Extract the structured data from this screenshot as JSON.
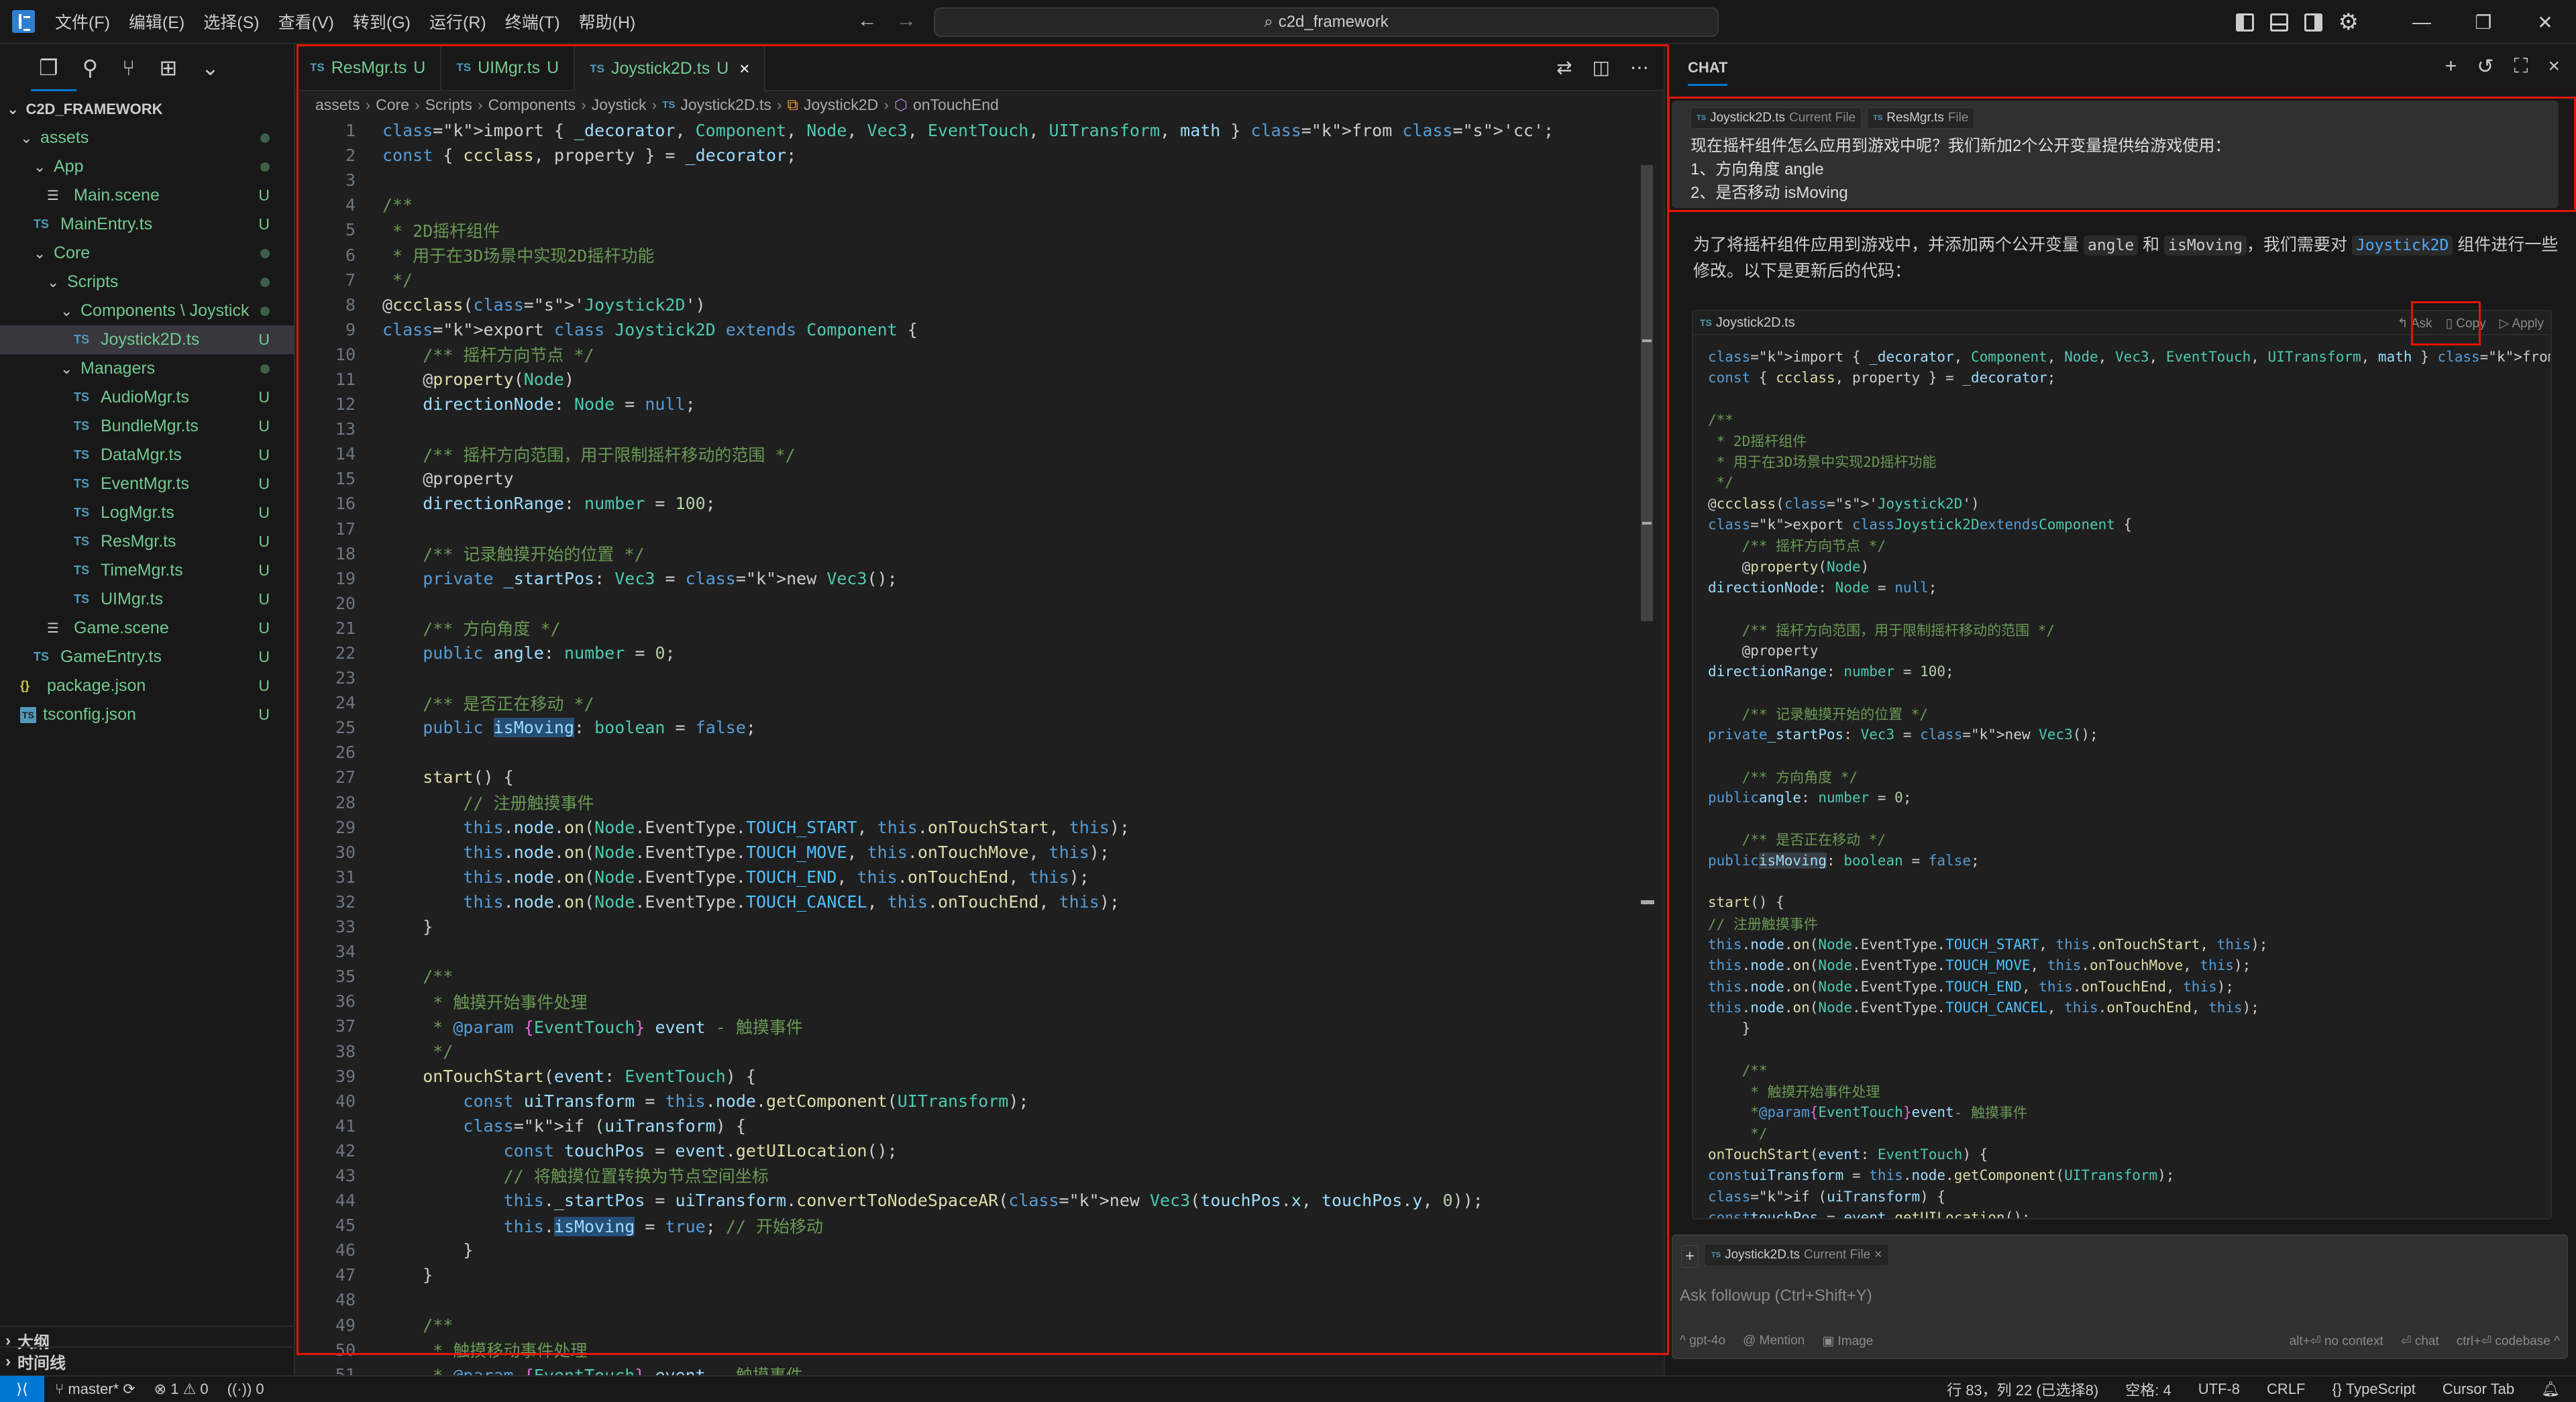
{
  "titlebar": {
    "menu": [
      "文件(F)",
      "编辑(E)",
      "选择(S)",
      "查看(V)",
      "转到(G)",
      "运行(R)",
      "终端(T)",
      "帮助(H)"
    ],
    "search_text": "c2d_framework",
    "nav_back": "←",
    "nav_forward": "→",
    "window_buttons": {
      "minimize": "—",
      "restore": "❐",
      "close": "✕"
    }
  },
  "sidebar": {
    "root": "C2D_FRAMEWORK",
    "tree": [
      {
        "label": "assets",
        "type": "folder",
        "depth": 1,
        "status": "dot"
      },
      {
        "label": "App",
        "type": "folder",
        "depth": 2,
        "status": "dot"
      },
      {
        "label": "Main.scene",
        "type": "scene",
        "depth": 3,
        "status": "U"
      },
      {
        "label": "MainEntry.ts",
        "type": "ts",
        "depth": 2,
        "status": "U"
      },
      {
        "label": "Core",
        "type": "folder",
        "depth": 2,
        "status": "dot"
      },
      {
        "label": "Scripts",
        "type": "folder",
        "depth": 3,
        "status": "dot"
      },
      {
        "label": "Components \\ Joystick",
        "type": "folder",
        "depth": 4,
        "status": "dot"
      },
      {
        "label": "Joystick2D.ts",
        "type": "ts",
        "depth": 5,
        "status": "U",
        "selected": true
      },
      {
        "label": "Managers",
        "type": "folder",
        "depth": 4,
        "status": "dot"
      },
      {
        "label": "AudioMgr.ts",
        "type": "ts",
        "depth": 5,
        "status": "U"
      },
      {
        "label": "BundleMgr.ts",
        "type": "ts",
        "depth": 5,
        "status": "U"
      },
      {
        "label": "DataMgr.ts",
        "type": "ts",
        "depth": 5,
        "status": "U"
      },
      {
        "label": "EventMgr.ts",
        "type": "ts",
        "depth": 5,
        "status": "U"
      },
      {
        "label": "LogMgr.ts",
        "type": "ts",
        "depth": 5,
        "status": "U"
      },
      {
        "label": "ResMgr.ts",
        "type": "ts",
        "depth": 5,
        "status": "U"
      },
      {
        "label": "TimeMgr.ts",
        "type": "ts",
        "depth": 5,
        "status": "U"
      },
      {
        "label": "UIMgr.ts",
        "type": "ts",
        "depth": 5,
        "status": "U"
      },
      {
        "label": "Game.scene",
        "type": "scene",
        "depth": 3,
        "status": "U"
      },
      {
        "label": "GameEntry.ts",
        "type": "ts",
        "depth": 2,
        "status": "U"
      },
      {
        "label": "package.json",
        "type": "json",
        "depth": 1,
        "status": "U"
      },
      {
        "label": "tsconfig.json",
        "type": "tsconfig",
        "depth": 1,
        "status": "U"
      }
    ],
    "outline_label": "大纲",
    "timeline_label": "时间线"
  },
  "editor": {
    "tabs": [
      {
        "label": "ResMgr.ts",
        "status": "U",
        "active": false
      },
      {
        "label": "UIMgr.ts",
        "status": "U",
        "active": false
      },
      {
        "label": "Joystick2D.ts",
        "status": "U",
        "active": true
      }
    ],
    "breadcrumb": [
      "assets",
      "Core",
      "Scripts",
      "Components",
      "Joystick",
      "Joystick2D.ts",
      "Joystick2D",
      "onTouchEnd"
    ],
    "lines": [
      "import { _decorator, Component, Node, Vec3, EventTouch, UITransform, math } from 'cc';",
      "const { ccclass, property } = _decorator;",
      "",
      "/**",
      " * 2D摇杆组件",
      " * 用于在3D场景中实现2D摇杆功能",
      " */",
      "@ccclass('Joystick2D')",
      "export class Joystick2D extends Component {",
      "    /** 摇杆方向节点 */",
      "    @property(Node)",
      "    directionNode: Node = null;",
      "",
      "    /** 摇杆方向范围，用于限制摇杆移动的范围 */",
      "    @property",
      "    directionRange: number = 100;",
      "",
      "    /** 记录触摸开始的位置 */",
      "    private _startPos: Vec3 = new Vec3();",
      "",
      "    /** 方向角度 */",
      "    public angle: number = 0;",
      "",
      "    /** 是否正在移动 */",
      "    public isMoving: boolean = false;",
      "",
      "    start() {",
      "        // 注册触摸事件",
      "        this.node.on(Node.EventType.TOUCH_START, this.onTouchStart, this);",
      "        this.node.on(Node.EventType.TOUCH_MOVE, this.onTouchMove, this);",
      "        this.node.on(Node.EventType.TOUCH_END, this.onTouchEnd, this);",
      "        this.node.on(Node.EventType.TOUCH_CANCEL, this.onTouchEnd, this);",
      "    }",
      "",
      "    /**",
      "     * 触摸开始事件处理",
      "     * @param {EventTouch} event - 触摸事件",
      "     */",
      "    onTouchStart(event: EventTouch) {",
      "        const uiTransform = this.node.getComponent(UITransform);",
      "        if (uiTransform) {",
      "            const touchPos = event.getUILocation();",
      "            // 将触摸位置转换为节点空间坐标",
      "            this._startPos = uiTransform.convertToNodeSpaceAR(new Vec3(touchPos.x, touchPos.y, 0));",
      "            this.isMoving = true; // 开始移动",
      "        }",
      "    }",
      "",
      "    /**",
      "     * 触摸移动事件处理",
      "     * @param {EventTouch} event - 触摸事件"
    ]
  },
  "chat": {
    "title": "CHAT",
    "user_message": {
      "context_chips": [
        {
          "file": "Joystick2D.ts",
          "tag": "Current File"
        },
        {
          "file": "ResMgr.ts",
          "tag": "File"
        }
      ],
      "lines": [
        "现在摇杆组件怎么应用到游戏中呢？我们新加2个公开变量提供给游戏使用：",
        "1、方向角度 angle",
        "2、是否移动 isMoving"
      ]
    },
    "reply": {
      "text_1": "为了将摇杆组件应用到游戏中，并添加两个公开变量",
      "code_angle": "angle",
      "text_and": "和",
      "code_ismoving": "isMoving",
      "text_2": "，我们需要对",
      "code_class": "Joystick2D",
      "text_3": "组件进行一些修改。以下是更新后的代码："
    },
    "codeblock": {
      "filename": "Joystick2D.ts",
      "actions": {
        "ask": "Ask",
        "copy": "Copy",
        "apply": "Apply"
      },
      "lines": [
        "import { _decorator, Component, Node, Vec3, EventTouch, UITransform, math } from 'cc';",
        "const { ccclass, property } = _decorator;",
        "",
        "/**",
        " * 2D摇杆组件",
        " * 用于在3D场景中实现2D摇杆功能",
        " */",
        "@ccclass('Joystick2D')",
        "export class Joystick2D extends Component {",
        "    /** 摇杆方向节点 */",
        "    @property(Node)",
        "    directionNode: Node = null;",
        "",
        "    /** 摇杆方向范围，用于限制摇杆移动的范围 */",
        "    @property",
        "    directionRange: number = 100;",
        "",
        "    /** 记录触摸开始的位置 */",
        "    private _startPos: Vec3 = new Vec3();",
        "",
        "    /** 方向角度 */",
        "    public angle: number = 0;",
        "",
        "    /** 是否正在移动 */",
        "    public isMoving: boolean = false;",
        "",
        "    start() {",
        "        // 注册触摸事件",
        "        this.node.on(Node.EventType.TOUCH_START, this.onTouchStart, this);",
        "        this.node.on(Node.EventType.TOUCH_MOVE, this.onTouchMove, this);",
        "        this.node.on(Node.EventType.TOUCH_END, this.onTouchEnd, this);",
        "        this.node.on(Node.EventType.TOUCH_CANCEL, this.onTouchEnd, this);",
        "    }",
        "",
        "    /**",
        "     * 触摸开始事件处理",
        "     * @param {EventTouch} event - 触摸事件",
        "     */",
        "    onTouchStart(event: EventTouch) {",
        "        const uiTransform = this.node.getComponent(UITransform);",
        "        if (uiTransform) {",
        "            const touchPos = event.getUILocation();"
      ]
    },
    "followup": {
      "chip_file": "Joystick2D.ts",
      "chip_tag": "Current File",
      "placeholder": "Ask followup (Ctrl+Shift+Y)",
      "model": "^ gpt-4o",
      "mention": "@ Mention",
      "image": "Image",
      "hint_no_context": "alt+⏎ no context",
      "hint_chat": "⏎ chat",
      "hint_codebase": "ctrl+⏎ codebase ^"
    }
  },
  "statusbar": {
    "branch": "master*",
    "errors": "1",
    "warnings": "0",
    "ports": "0",
    "position": "行 83，列 22 (已选择8)",
    "indent": "空格: 4",
    "encoding": "UTF-8",
    "eol": "CRLF",
    "language": "TypeScript",
    "cursor_tab": "Cursor Tab"
  },
  "colors": {
    "accent": "#0078d4",
    "git_untracked": "#73c991",
    "ts_icon": "#519aba",
    "annotation_red": "#e51400"
  }
}
